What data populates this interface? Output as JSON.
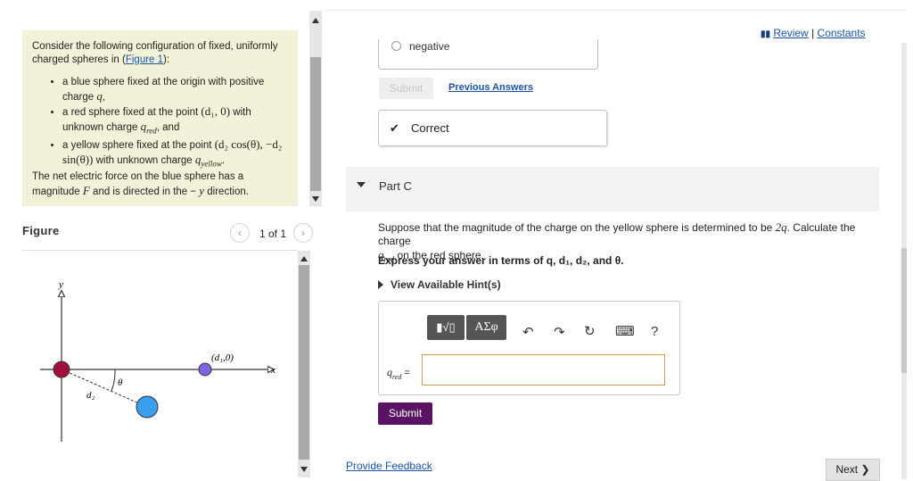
{
  "problem": {
    "intro_a": "Consider the following configuration of fixed, uniformly charged spheres in (",
    "figure_link": "Figure 1",
    "intro_b": "):",
    "items": [
      [
        "a blue sphere fixed at the origin with positive charge ",
        "q",
        ","
      ],
      [
        "a red sphere fixed at the point ",
        "(d₁, 0)",
        " with unknown charge ",
        "q",
        "red",
        ", and"
      ],
      [
        "a yellow sphere fixed at the point ",
        "(d₂ cos(θ), −d₂ sin(θ))",
        " with unknown charge ",
        "q",
        "yellow",
        "."
      ]
    ],
    "outro_a": "The net electric force on the blue sphere has a magnitude ",
    "outro_F": "F",
    "outro_b": " and is directed in the − ",
    "outro_y": "y",
    "outro_c": " direction."
  },
  "figure": {
    "label": "Figure",
    "pager": "1 of 1",
    "prev": "‹",
    "next": "›",
    "axis_y": "y",
    "axis_x": "x",
    "point_label": "(d₁,0)",
    "theta": "θ",
    "d2": "d₂",
    "colors": {
      "red_sphere": "#a0103a",
      "blue_sphere": "#3a9df0",
      "purple_sphere": "#7f63e0"
    }
  },
  "header": {
    "review_icon": "book-icon",
    "review": "Review",
    "sep": "|",
    "constants": "Constants"
  },
  "partB": {
    "option_label": "negative",
    "submit_label": "Submit",
    "prev_answers": "Previous Answers",
    "correct_label": "Correct",
    "correct_icon": "✔"
  },
  "partC": {
    "title": "Part C",
    "q_a": "Suppose that the magnitude of the charge on the yellow sphere is determined to be ",
    "q_val": "2q",
    "q_b": ". Calculate the charge ",
    "q_var": "q",
    "q_sub": "red",
    "q_c": " on the red sphere.",
    "express": "Express your answer in terms of q, d₁, d₂, and θ.",
    "hint": "View Available Hint(s)",
    "answer_label_var": "q",
    "answer_label_sub": "red",
    "answer_label_eq": " =",
    "answer_value": "",
    "toolbar": {
      "templates": "▮√▯",
      "greek": "ΑΣφ",
      "undo": "↶",
      "redo": "↷",
      "reset": "↻",
      "keyboard": "⌨",
      "help": "?"
    },
    "submit_label": "Submit"
  },
  "footer": {
    "feedback": "Provide Feedback",
    "next": "Next ❯"
  }
}
